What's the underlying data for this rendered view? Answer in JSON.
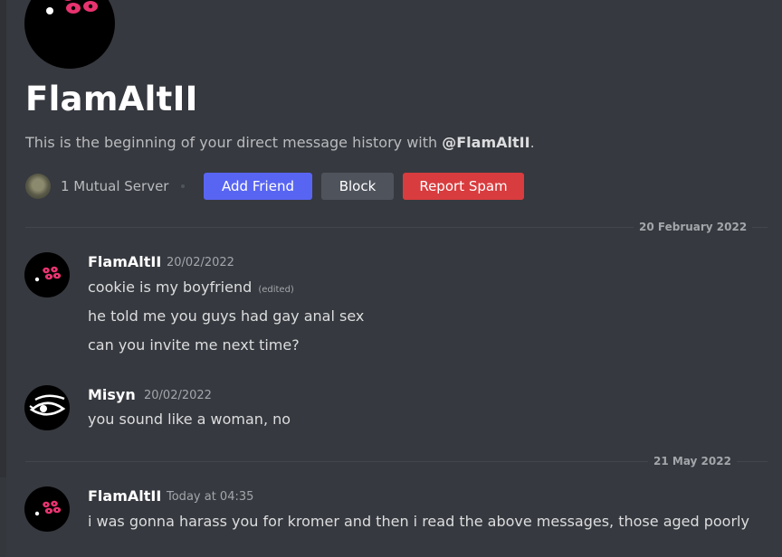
{
  "header": {
    "title": "FlamAltII",
    "intro_prefix": "This is the beginning of your direct message history with ",
    "intro_mention": "@FlamAltII",
    "intro_suffix": ".",
    "mutual_servers": "1 Mutual Server",
    "add_friend_label": "Add Friend",
    "block_label": "Block",
    "report_spam_label": "Report Spam"
  },
  "colors": {
    "background": "#36393f",
    "add_friend": "#5865f2",
    "block": "#4f545c",
    "report_spam": "#d83c3e",
    "avatar_accent": "#e8336f"
  },
  "icons": {
    "flam_avatar": "pink-dots-avatar-icon",
    "misyn_avatar": "eye-avatar-icon",
    "server": "server-icon"
  },
  "dividers": [
    {
      "label": "20 February 2022"
    },
    {
      "label": "21 May 2022"
    }
  ],
  "messages": [
    {
      "author": "FlamAltII",
      "timestamp": "20/02/2022",
      "lines": [
        "cookie is my boyfriend",
        "he told me you guys had gay anal sex",
        "can you invite me next time?"
      ],
      "edited_label": "(edited)"
    },
    {
      "author": "Misyn",
      "timestamp": "20/02/2022",
      "lines": [
        "you sound like a woman, no"
      ]
    },
    {
      "author": "FlamAltII",
      "timestamp": "Today at 04:35",
      "lines": [
        "i was gonna harass you for kromer and then i read the above messages, those aged poorly"
      ]
    }
  ]
}
